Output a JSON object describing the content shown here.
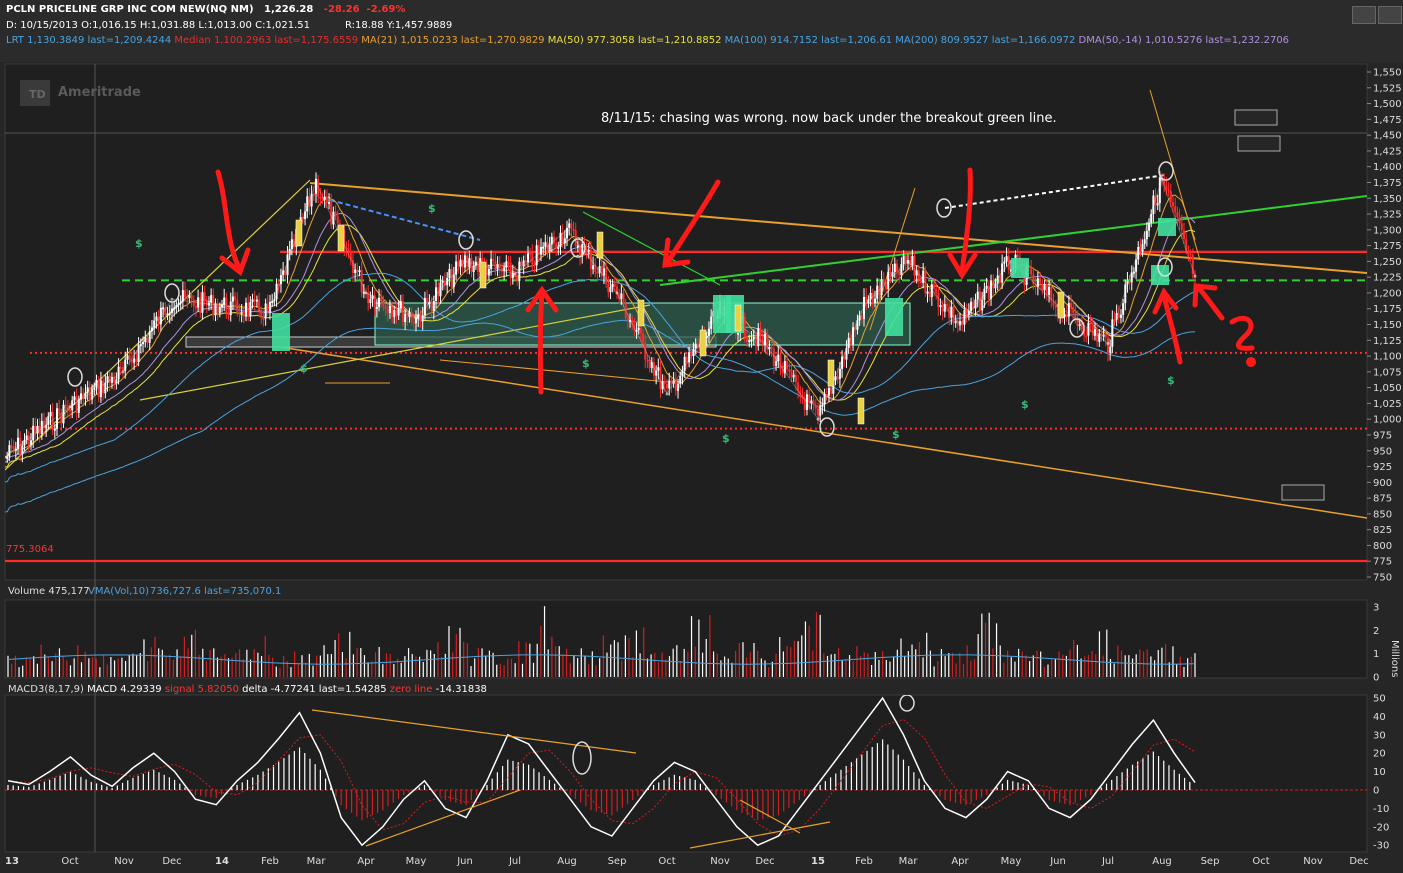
{
  "header": {
    "symbol_line": "PCLN PRICELINE GRP INC COM NEW(NQ NM)",
    "last_price": "1,226.28",
    "change": "-28.26",
    "change_pct": "-2.69%",
    "ohlc_line": "D: 10/15/2013 O:1,016.15 H:1,031.88 L:1,013.00 C:1,021.51",
    "range_line": "R:18.88 Y:1,457.9889",
    "indicators": [
      {
        "text": "LRT",
        "color": "#4aa3df"
      },
      {
        "text": "1,130.3849 last=1,209.4244",
        "color": "#4aa3df"
      },
      {
        "text": "Median",
        "color": "#e03030"
      },
      {
        "text": "1,100.2963 last=1,175.6559",
        "color": "#e03030"
      },
      {
        "text": "MA(21)",
        "color": "#e8a030"
      },
      {
        "text": "1,015.0233 last=1,270.9829",
        "color": "#e8a030"
      },
      {
        "text": "MA(50)",
        "color": "#e8e040"
      },
      {
        "text": "977.3058 last=1,210.8852",
        "color": "#e8e040"
      },
      {
        "text": "MA(100)",
        "color": "#4aa3df"
      },
      {
        "text": "914.7152 last=1,206.61",
        "color": "#4aa3df"
      },
      {
        "text": "MA(200)",
        "color": "#4aa3df"
      },
      {
        "text": "809.9527 last=1,166.0972",
        "color": "#4aa3df"
      },
      {
        "text": "DMA(50,-14)",
        "color": "#b090e0"
      },
      {
        "text": "1,010.5276 last=1,232.2706",
        "color": "#b090e0"
      }
    ]
  },
  "watermark": "Ameritrade",
  "annotation": "8/11/15: chasing was wrong. now back under the breakout green line.",
  "volume_label": "Volume 475,177",
  "vma_label": "VMA(Vol,10)",
  "vma_value": "736,727.6 last=735,070.1",
  "macd_label": "MACD3(8,17,9)",
  "macd_value": "MACD 4.29339",
  "macd_signal": "signal 5.82050",
  "macd_delta": "delta -4.77241 last=1.54285",
  "macd_delta_last": "-14.31838",
  "price_level_label": "775.3064",
  "chart_data": {
    "type": "line",
    "title": "PCLN PRICELINE GRP INC COM NEW(NQ NM)",
    "x_ticks": [
      "13",
      "Oct",
      "Nov",
      "Dec",
      "14",
      "Feb",
      "Mar",
      "Apr",
      "May",
      "Jun",
      "Jul",
      "Aug",
      "Sep",
      "Oct",
      "Nov",
      "Dec",
      "15",
      "Feb",
      "Mar",
      "Apr",
      "May",
      "Jun",
      "Jul",
      "Aug",
      "Sep",
      "Oct",
      "Nov",
      "Dec"
    ],
    "price_axis": {
      "ticks": [
        1550,
        1525,
        1500,
        1475,
        1450,
        1425,
        1400,
        1375,
        1350,
        1325,
        1300,
        1275,
        1250,
        1225,
        1200,
        1175,
        1150,
        1125,
        1100,
        1075,
        1050,
        1025,
        1000,
        975,
        950,
        925,
        900,
        875,
        850,
        825,
        800,
        775,
        750
      ],
      "ylim": [
        740,
        1560
      ]
    },
    "volume_axis": {
      "ticks": [
        "3",
        "2",
        "1",
        "0"
      ],
      "unit": "Millions"
    },
    "macd_axis": {
      "ticks": [
        50,
        40,
        30,
        20,
        10,
        0,
        -10,
        -20,
        -30
      ],
      "ylim": [
        -33,
        52
      ]
    },
    "horizontal_levels": [
      {
        "value": 1265,
        "color": "#ff2a2a",
        "style": "solid"
      },
      {
        "value": 1220,
        "color": "#30d030",
        "style": "dashed"
      },
      {
        "value": 1105,
        "color": "#ff2a2a",
        "style": "dotted"
      },
      {
        "value": 985,
        "color": "#ff2a2a",
        "style": "dotted"
      },
      {
        "value": 775.3064,
        "color": "#ff2a2a",
        "style": "solid"
      }
    ],
    "price_series": {
      "name": "PCLN",
      "points": [
        [
          "Sep 13",
          940
        ],
        [
          "Oct 13",
          1020
        ],
        [
          "Nov 13",
          1075
        ],
        [
          "Dec 13",
          1190
        ],
        [
          "Jan 14",
          1180
        ],
        [
          "Feb 14",
          1170
        ],
        [
          "Mar 14",
          1375
        ],
        [
          "Apr 14",
          1200
        ],
        [
          "May 14",
          1160
        ],
        [
          "Jun 14",
          1250
        ],
        [
          "Jul 14",
          1230
        ],
        [
          "Aug 14",
          1300
        ],
        [
          "Sep 14",
          1200
        ],
        [
          "Oct 14",
          1040
        ],
        [
          "Nov 14",
          1170
        ],
        [
          "Dec 14",
          1120
        ],
        [
          "Jan 15",
          1000
        ],
        [
          "Feb 15",
          1180
        ],
        [
          "Mar 15",
          1250
        ],
        [
          "Apr 15",
          1150
        ],
        [
          "May 15",
          1250
        ],
        [
          "Jun 15",
          1180
        ],
        [
          "Jul 15",
          1120
        ],
        [
          "Aug 15",
          1380
        ],
        [
          "Aug 15",
          1226.28
        ]
      ]
    },
    "volume_series": {
      "name": "Volume",
      "values_millions": [
        0.8,
        1.0,
        0.9,
        1.2,
        0.7,
        0.8,
        1.3,
        1.0,
        1.9,
        1.1,
        0.9,
        1.4,
        0.8,
        0.9,
        1.2,
        1.6,
        1.0,
        0.8,
        0.9,
        1.2,
        1.8,
        0.9,
        0.8,
        1.1,
        2.2,
        1.0,
        0.9,
        1.3,
        1.7,
        0.8,
        1.0,
        1.9,
        0.9,
        1.1,
        0.8,
        1.5,
        2.1,
        0.9,
        1.0,
        0.8,
        1.2,
        1.4,
        0.9,
        1.0,
        2.0,
        1.1,
        0.9,
        0.8,
        1.2,
        1.5,
        1.0,
        0.9,
        1.1,
        0.8
      ]
    },
    "macd_series": {
      "name": "MACD",
      "values": [
        5,
        3,
        10,
        18,
        8,
        2,
        12,
        20,
        10,
        -5,
        -8,
        5,
        15,
        28,
        42,
        20,
        -15,
        -30,
        -20,
        -5,
        5,
        -10,
        -15,
        5,
        30,
        25,
        10,
        -5,
        -20,
        -25,
        -10,
        5,
        15,
        10,
        -5,
        -20,
        -30,
        -25,
        -10,
        5,
        20,
        35,
        50,
        30,
        5,
        -10,
        -15,
        -5,
        10,
        5,
        -10,
        -15,
        -5,
        10,
        25,
        38,
        20,
        4
      ]
    }
  }
}
